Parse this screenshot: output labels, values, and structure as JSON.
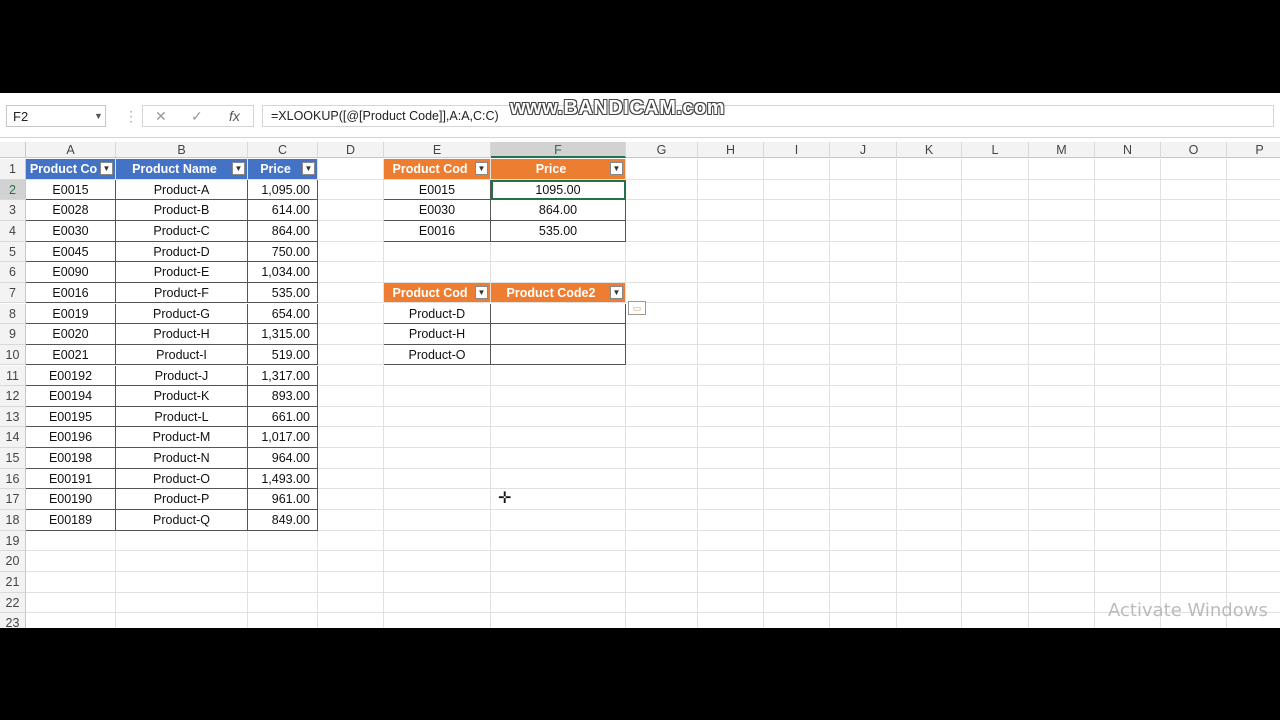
{
  "name_box": "F2",
  "formula": "=XLOOKUP([@[Product Code]],A:A,C:C)",
  "watermark": "www.BANDICAM.com",
  "activate_text": "Activate Windows",
  "columns": [
    "A",
    "B",
    "C",
    "D",
    "E",
    "F",
    "G",
    "H",
    "I",
    "J",
    "K",
    "L",
    "M",
    "N",
    "O",
    "P"
  ],
  "rows": [
    "1",
    "2",
    "3",
    "4",
    "5",
    "6",
    "7",
    "8",
    "9",
    "10",
    "11",
    "12",
    "13",
    "14",
    "15",
    "16",
    "17",
    "18",
    "19",
    "20",
    "21",
    "22",
    "23"
  ],
  "main_table": {
    "headers": [
      "Product Co",
      "Product Name",
      "Price"
    ],
    "rows": [
      [
        "E0015",
        "Product-A",
        "1,095.00"
      ],
      [
        "E0028",
        "Product-B",
        "614.00"
      ],
      [
        "E0030",
        "Product-C",
        "864.00"
      ],
      [
        "E0045",
        "Product-D",
        "750.00"
      ],
      [
        "E0090",
        "Product-E",
        "1,034.00"
      ],
      [
        "E0016",
        "Product-F",
        "535.00"
      ],
      [
        "E0019",
        "Product-G",
        "654.00"
      ],
      [
        "E0020",
        "Product-H",
        "1,315.00"
      ],
      [
        "E0021",
        "Product-I",
        "519.00"
      ],
      [
        "E00192",
        "Product-J",
        "1,317.00"
      ],
      [
        "E00194",
        "Product-K",
        "893.00"
      ],
      [
        "E00195",
        "Product-L",
        "661.00"
      ],
      [
        "E00196",
        "Product-M",
        "1,017.00"
      ],
      [
        "E00198",
        "Product-N",
        "964.00"
      ],
      [
        "E00191",
        "Product-O",
        "1,493.00"
      ],
      [
        "E00190",
        "Product-P",
        "961.00"
      ],
      [
        "E00189",
        "Product-Q",
        "849.00"
      ]
    ]
  },
  "lookup_table": {
    "headers": [
      "Product Cod",
      "Price"
    ],
    "rows": [
      [
        "E0015",
        "1095.00"
      ],
      [
        "E0030",
        "864.00"
      ],
      [
        "E0016",
        "535.00"
      ]
    ]
  },
  "lookup_table2": {
    "headers": [
      "Product Cod",
      "Product Code2"
    ],
    "rows": [
      [
        "Product-D",
        ""
      ],
      [
        "Product-H",
        ""
      ],
      [
        "Product-O",
        ""
      ]
    ]
  },
  "colors": {
    "blue_header": "#4472c4",
    "orange_header": "#ed7d31",
    "selection": "#217346"
  }
}
